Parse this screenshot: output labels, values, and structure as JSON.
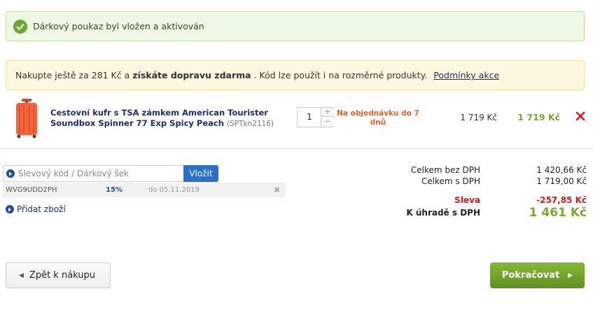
{
  "alerts": {
    "success_text": "Dárkový poukaz byl vložen a aktivován",
    "shipping_prefix": "Nakupte ještě za 281 Kč a",
    "shipping_bold": "získáte dopravu zdarma",
    "shipping_suffix": ". Kód lze použít i na rozměrné produkty.",
    "terms_link": "Podmínky akce"
  },
  "cart": {
    "item": {
      "name": "Cestovní kufr s TSA zámkem American Tourister Soundbox Spinner 77 Exp Spicy Peach",
      "code": "(SPTkn2116)",
      "quantity": "1",
      "availability": "Na objednávku do 7 dnů",
      "unit_price": "1 719 Kč",
      "total_price": "1 719 Kč"
    }
  },
  "voucher": {
    "placeholder": "Slevový kód / Dárkový šek",
    "apply_label": "Vložit",
    "applied": {
      "code": "WVG9UDD2PH",
      "discount": "15%",
      "valid_until": "do 05.11.2019"
    },
    "add_product_label": "Přidat zboží"
  },
  "summary": {
    "net_label": "Celkem bez DPH",
    "net_value": "1 420,66 Kč",
    "gross_label": "Celkem s DPH",
    "gross_value": "1 719,00 Kč",
    "discount_label": "Sleva",
    "discount_value": "-257,85 Kč",
    "to_pay_label": "K úhradě s DPH",
    "to_pay_value": "1 461 Kč"
  },
  "actions": {
    "back_label": "Zpět k nákupu",
    "continue_label": "Pokračovat"
  }
}
